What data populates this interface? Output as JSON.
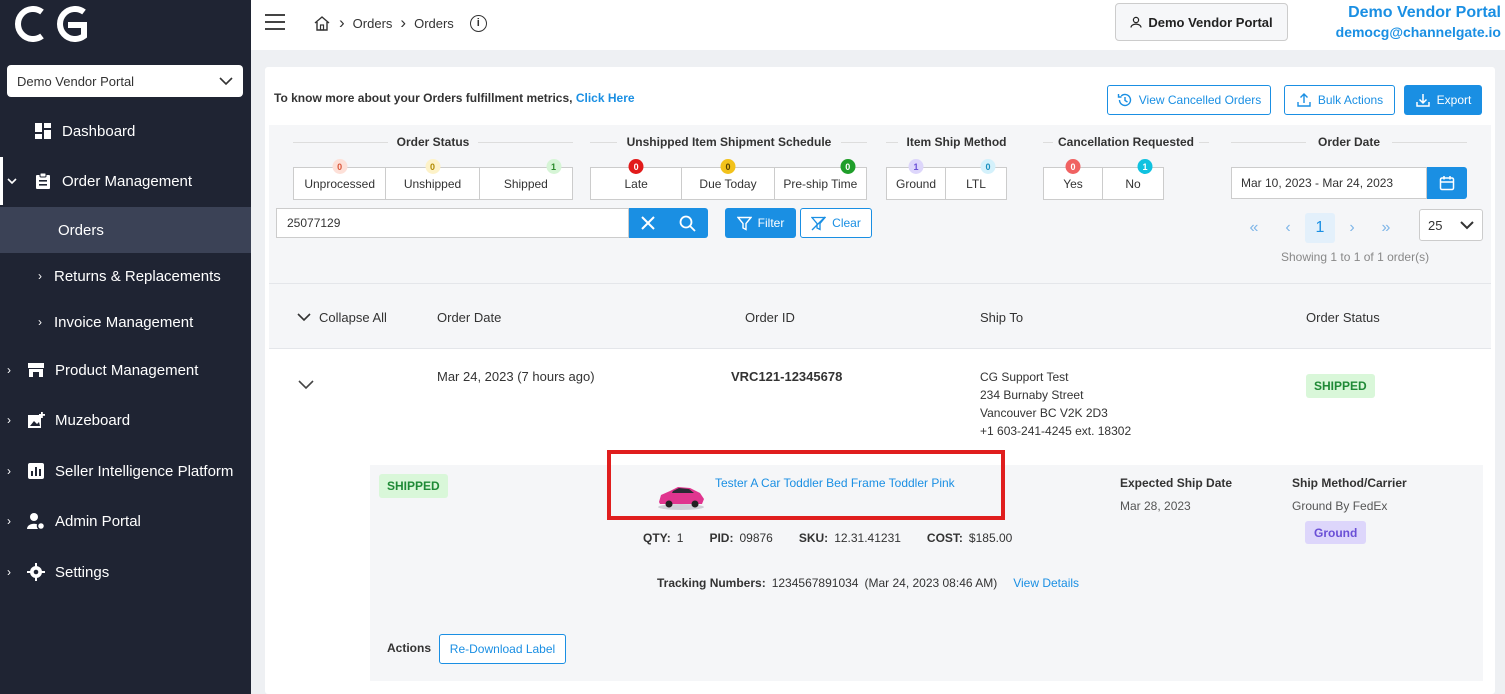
{
  "brand": {
    "logo_text": "CG"
  },
  "sidebar": {
    "vendor_select": "Demo Vendor Portal",
    "items": [
      {
        "label": "Dashboard"
      },
      {
        "label": "Order Management"
      },
      {
        "label": "Orders"
      },
      {
        "label": "Returns & Replacements"
      },
      {
        "label": "Invoice Management"
      },
      {
        "label": "Product Management"
      },
      {
        "label": "Muzeboard"
      },
      {
        "label": "Seller Intelligence Platform"
      },
      {
        "label": "Admin Portal"
      },
      {
        "label": "Settings"
      }
    ]
  },
  "topbar": {
    "breadcrumb": [
      "Orders",
      "Orders"
    ],
    "vendor_button": "Demo Vendor Portal",
    "user_name": "Demo Vendor Portal",
    "user_email": "democg@channelgate.io"
  },
  "toolbar": {
    "metrics_text": "To know more about your Orders fulfillment metrics,",
    "metrics_link": "Click Here",
    "view_cancelled": "View Cancelled Orders",
    "bulk_actions": "Bulk Actions",
    "export": "Export"
  },
  "filters": {
    "order_status": {
      "title": "Order Status",
      "options": [
        {
          "label": "Unprocessed",
          "count": "0"
        },
        {
          "label": "Unshipped",
          "count": "0"
        },
        {
          "label": "Shipped",
          "count": "1"
        }
      ]
    },
    "shipment_schedule": {
      "title": "Unshipped Item Shipment Schedule",
      "options": [
        {
          "label": "Late",
          "count": "0"
        },
        {
          "label": "Due Today",
          "count": "0"
        },
        {
          "label": "Pre-ship Time",
          "count": "0"
        }
      ]
    },
    "ship_method": {
      "title": "Item Ship Method",
      "options": [
        {
          "label": "Ground",
          "count": "1"
        },
        {
          "label": "LTL",
          "count": "0"
        }
      ]
    },
    "cancellation": {
      "title": "Cancellation Requested",
      "options": [
        {
          "label": "Yes",
          "count": "0"
        },
        {
          "label": "No",
          "count": "1"
        }
      ]
    },
    "order_date": {
      "title": "Order Date",
      "value": "Mar 10, 2023 - Mar 24, 2023"
    },
    "search_value": "25077129",
    "filter_label": "Filter",
    "clear_label": "Clear"
  },
  "pagination": {
    "current_page": "1",
    "per_page": "25",
    "showing": "Showing 1 to 1 of 1 order(s)"
  },
  "table": {
    "headers": {
      "collapse_all": "Collapse All",
      "order_date": "Order Date",
      "order_id": "Order ID",
      "ship_to": "Ship To",
      "order_status": "Order Status"
    },
    "row": {
      "order_date": "Mar 24, 2023 (7 hours ago)",
      "order_id": "VRC121-12345678",
      "ship_to": [
        "CG Support Test",
        "234 Burnaby Street",
        "Vancouver BC V2K 2D3",
        "+1 603-241-4245 ext. 18302"
      ],
      "status": "SHIPPED"
    },
    "item": {
      "status": "SHIPPED",
      "product_name": "Tester A Car Toddler Bed Frame Toddler Pink",
      "qty_label": "QTY:",
      "qty": "1",
      "pid_label": "PID:",
      "pid": "09876",
      "sku_label": "SKU:",
      "sku": "12.31.41231",
      "cost_label": "COST:",
      "cost": "$185.00",
      "tracking_label": "Tracking Numbers:",
      "tracking": "1234567891034",
      "tracking_time": "(Mar 24, 2023 08:46 AM)",
      "view_details": "View Details",
      "expected_ship_label": "Expected Ship Date",
      "expected_ship_date": "Mar 28, 2023",
      "ship_method_label": "Ship Method/Carrier",
      "ship_method": "Ground By FedEx",
      "ship_tag": "Ground",
      "actions_label": "Actions",
      "redownload": "Re-Download Label"
    }
  },
  "colors": {
    "sidebar_bg": "#1f2433",
    "accent": "#1a8fe3",
    "highlight_box": "#e01e1e",
    "shipped_bg": "#d9f7d9"
  }
}
